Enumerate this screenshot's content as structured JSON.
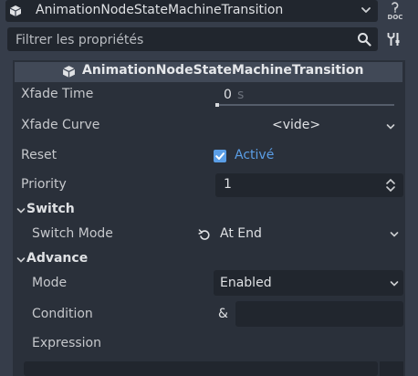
{
  "object_selector": {
    "name": "AnimationNodeStateMachineTransition",
    "icon": "node-cube-icon",
    "doc_label": "DOC"
  },
  "filter": {
    "placeholder": "Filtrer les propriétés"
  },
  "inspector": {
    "title": "AnimationNodeStateMachineTransition",
    "properties": {
      "xfade_time": {
        "label": "Xfade Time",
        "value": "0",
        "unit": "s",
        "slider_fraction": 0
      },
      "xfade_curve": {
        "label": "Xfade Curve",
        "value": "<vide>"
      },
      "reset": {
        "label": "Reset",
        "checked": true,
        "text": "Activé"
      },
      "priority": {
        "label": "Priority",
        "value": "1"
      }
    },
    "sections": {
      "switch": {
        "title": "Switch",
        "switch_mode": {
          "label": "Switch Mode",
          "value": "At End"
        }
      },
      "advance": {
        "title": "Advance",
        "mode": {
          "label": "Mode",
          "value": "Enabled"
        },
        "condition": {
          "label": "Condition",
          "prefix": "&",
          "value": ""
        },
        "expression": {
          "label": "Expression",
          "value": ""
        }
      }
    }
  },
  "colors": {
    "background": "#363d4a",
    "panel": "#2a303a",
    "field": "#21262e",
    "header": "#414957",
    "accent": "#5b9ee6"
  }
}
